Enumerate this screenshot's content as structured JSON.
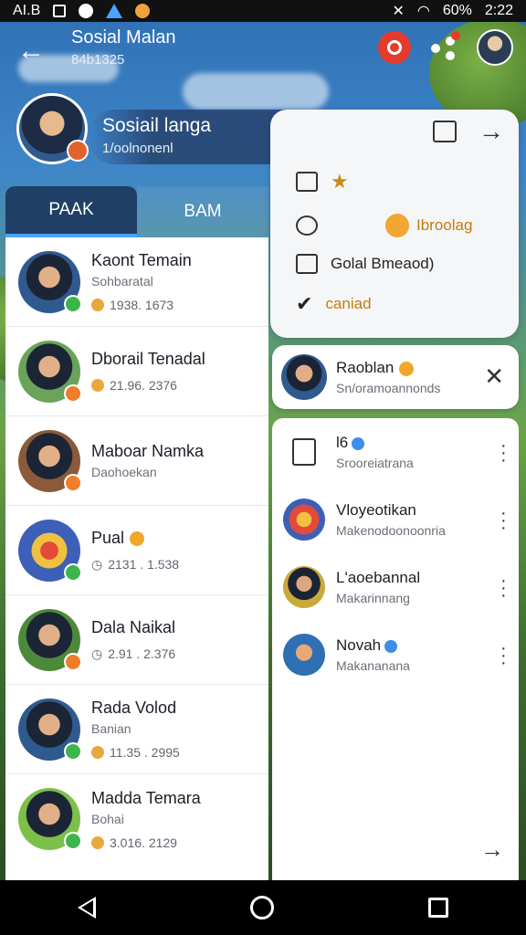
{
  "status_bar": {
    "carrier": "AI.B",
    "battery": "60%",
    "time": "2:22"
  },
  "header": {
    "title": "Sosial Malan",
    "subtitle": "84b1325"
  },
  "profile": {
    "name": "Sosiail langa",
    "status": "1/oolnonenl"
  },
  "tabs": [
    {
      "label": "PAAK"
    },
    {
      "label": "BAM"
    }
  ],
  "contacts": [
    {
      "name": "Kaont Temain",
      "sub": "Sohbaratal",
      "meta": "1938. 1673",
      "status": "online"
    },
    {
      "name": "Dborail Tenadal",
      "sub": "",
      "meta": "21.96. 2376",
      "status": "away"
    },
    {
      "name": "Maboar Namka",
      "sub": "Daohoekan",
      "meta": "",
      "status": "away"
    },
    {
      "name": "Pual",
      "sub": "",
      "meta": "2131 . 1.538",
      "status": "online",
      "badge": true
    },
    {
      "name": "Dala Naikal",
      "sub": "",
      "meta": "2.91 . 2.376",
      "status": "away"
    },
    {
      "name": "Rada Volod",
      "sub": "Banian",
      "meta": "11.35 . 2995",
      "status": "online"
    },
    {
      "name": "Madda Temara",
      "sub": "Bohai",
      "meta": "3.016. 2129",
      "status": "online"
    }
  ],
  "menu": {
    "item1_label": "",
    "item2_label": "Ibroolag",
    "item3_label": "Golal Bmeaod)",
    "item4_label": "caniad"
  },
  "selected_contact": {
    "name": "Raoblan",
    "sub": "Sn/oramoannonds"
  },
  "right_list": [
    {
      "name": "l6",
      "sub": "Srooreiatrana",
      "verified": true
    },
    {
      "name": "Vloyeotikan",
      "sub": "Makenodoonoonria"
    },
    {
      "name": "L'aoebannal",
      "sub": "Makarinnang"
    },
    {
      "name": "Novah",
      "sub": "Makananana",
      "verified": true
    }
  ]
}
